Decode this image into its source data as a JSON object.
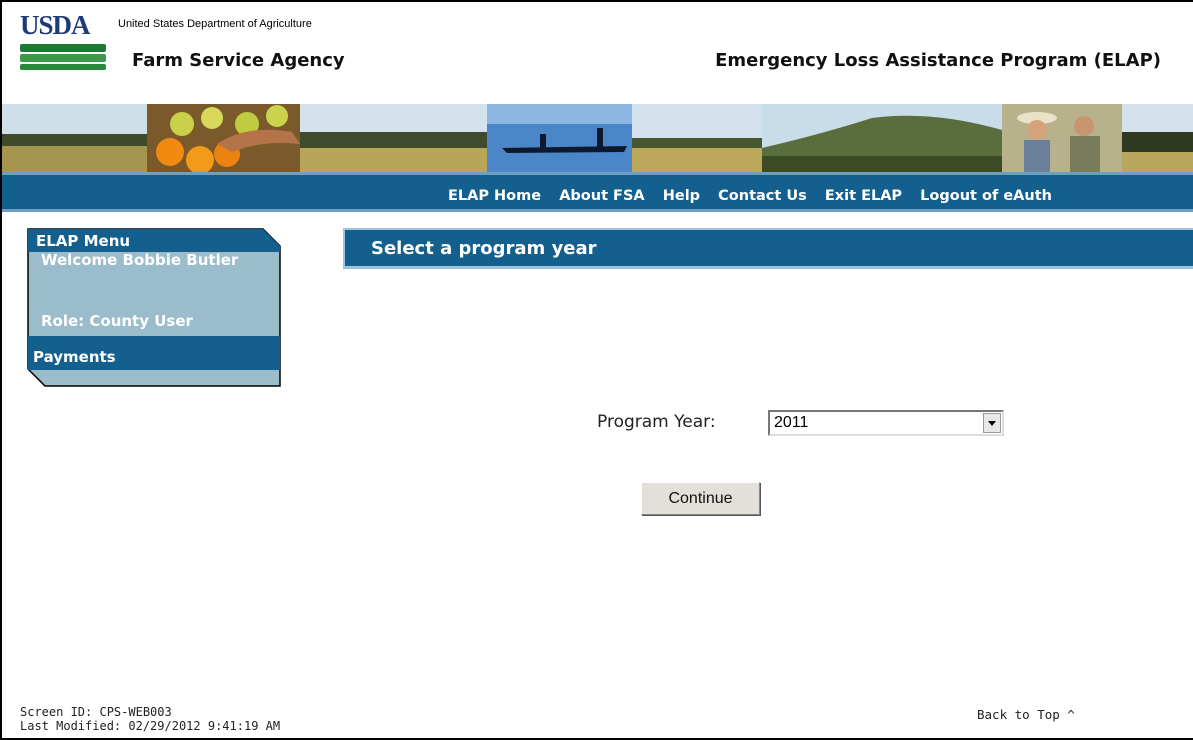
{
  "header": {
    "logo_text": "USDA",
    "department": "United States Department of Agriculture",
    "agency": "Farm Service Agency",
    "program_title": "Emergency Loss Assistance Program (ELAP)"
  },
  "nav": {
    "links": [
      "ELAP Home",
      "About FSA",
      "Help",
      "Contact Us",
      "Exit ELAP",
      "Logout of eAuth"
    ]
  },
  "menu": {
    "title": "ELAP Menu",
    "welcome": "Welcome Bobbie Butler",
    "role": "Role: County User",
    "payments": "Payments"
  },
  "main": {
    "page_title": "Select a program year",
    "program_year_label": "Program Year:",
    "program_year_value": "2011",
    "continue_label": "Continue"
  },
  "footer": {
    "screen_id": "Screen ID: CPS-WEB003",
    "last_modified": "Last Modified: 02/29/2012 9:41:19 AM",
    "back_to_top": "Back to Top ^"
  },
  "colors": {
    "nav_blue": "#13608e",
    "menu_light": "#9bbccb",
    "usda_blue": "#1d3b76",
    "usda_green": "#2e8b3a"
  }
}
